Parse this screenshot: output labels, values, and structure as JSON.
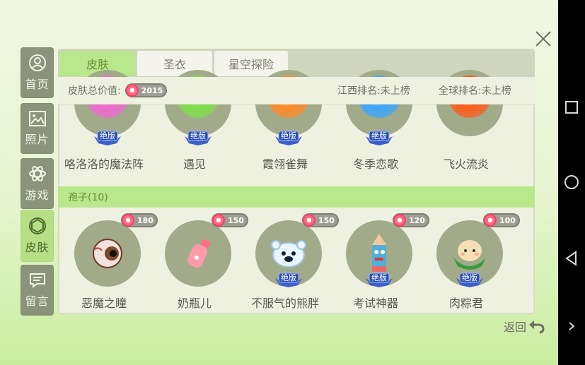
{
  "tabs": [
    "皮肤",
    "圣衣",
    "星空探险"
  ],
  "side_nav": [
    {
      "label": "首页",
      "icon": "avatar-icon"
    },
    {
      "label": "照片",
      "icon": "photo-icon"
    },
    {
      "label": "游戏",
      "icon": "atom-icon"
    },
    {
      "label": "皮肤",
      "icon": "skin-icon"
    },
    {
      "label": "留言",
      "icon": "message-icon"
    }
  ],
  "info": {
    "total_label": "皮肤总价值:",
    "total_value": "2015",
    "rank_jiangxi": "江西排名:未上榜",
    "rank_global": "全球排名:未上榜"
  },
  "row1": [
    {
      "name": "咯洛洛的魔法阵",
      "badge": "绝版",
      "orb": "#f06ad2"
    },
    {
      "name": "遇见",
      "badge": "绝版",
      "orb": "#7ee04a"
    },
    {
      "name": "霞翎雀舞",
      "badge": "绝版",
      "orb": "#ff8a2a"
    },
    {
      "name": "冬季恋歌",
      "badge": "绝版",
      "orb": "#3aa6ff"
    },
    {
      "name": "飞火流炎",
      "badge": "",
      "orb": "#ff5a18"
    }
  ],
  "section_title": "孢子(10)",
  "row2": [
    {
      "name": "恶魔之瞳",
      "price": "180",
      "badge": "",
      "icon": "eye-icon"
    },
    {
      "name": "奶瓶儿",
      "price": "150",
      "badge": "",
      "icon": "bottle-icon"
    },
    {
      "name": "不服气的熊胖",
      "price": "150",
      "badge": "绝版",
      "icon": "bear-icon"
    },
    {
      "name": "考试神器",
      "price": "120",
      "badge": "绝版",
      "icon": "pencil-icon"
    },
    {
      "name": "肉粽君",
      "price": "100",
      "badge": "绝版",
      "icon": "zongzi-icon"
    }
  ],
  "back_label": "返回",
  "colors": {
    "accent": "#b9e78b",
    "accent_text": "#6c8a3d",
    "side_tab": "#8b947a"
  }
}
